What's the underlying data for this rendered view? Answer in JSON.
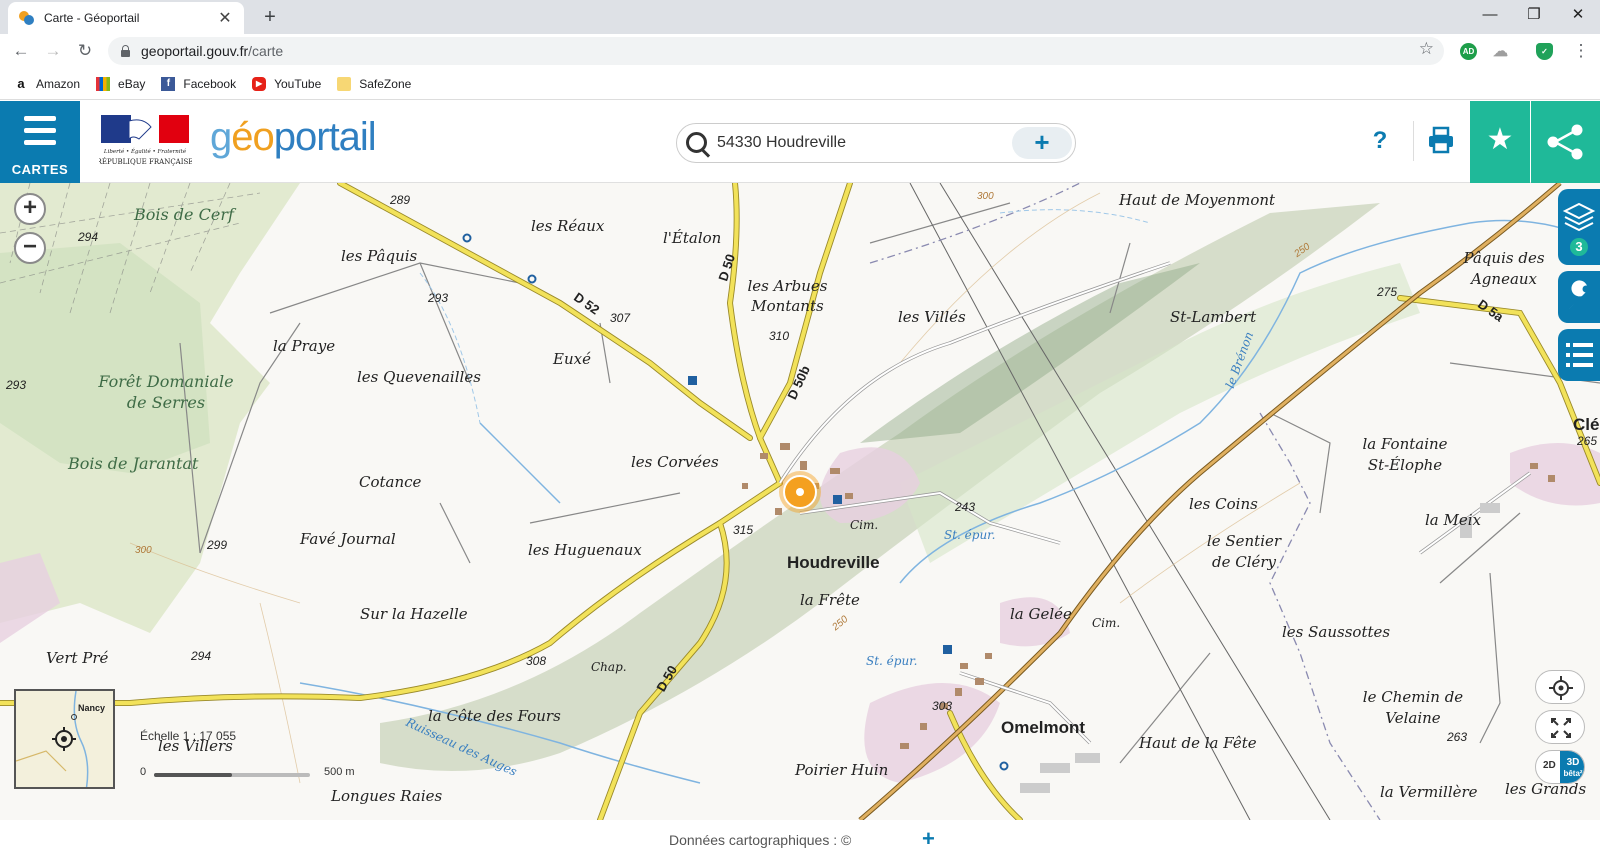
{
  "browser": {
    "tab_title": "Carte - Géoportail",
    "new_tab": "+",
    "url_host": "geoportail.gouv.fr",
    "url_path": "/carte",
    "bookmarks": [
      {
        "label": "Amazon",
        "icon": "amazon-icon"
      },
      {
        "label": "eBay",
        "icon": "ebay-icon"
      },
      {
        "label": "Facebook",
        "icon": "facebook-icon"
      },
      {
        "label": "YouTube",
        "icon": "youtube-icon"
      },
      {
        "label": "SafeZone",
        "icon": "folder-icon"
      }
    ],
    "extensions": [
      {
        "label": "AD",
        "color": "#1e9e4a"
      },
      {
        "label": "",
        "color": "#9e9e9e"
      },
      {
        "label": "✓",
        "color": "#20a25a"
      }
    ]
  },
  "header": {
    "menu_label": "CARTES",
    "logo_g": "g",
    "logo_e": "éo",
    "logo_rest": "portail",
    "marianne_line1": "Liberté • Égalité • Fraternité",
    "marianne_line2": "RÉPUBLIQUE FRANÇAISE",
    "search_value": "54330 Houdreville",
    "search_plus": "+",
    "help": "?",
    "colors": {
      "primary": "#0b7bb0",
      "accent": "#1fb999",
      "logo_orange": "#f0a020"
    }
  },
  "map": {
    "layers_count": "3",
    "place_labels": [
      "Bois de Cerf",
      "les Pâquis",
      "les Réaux",
      "l'Étalon",
      "Haut de Moyenmont",
      "les Arbues Montants",
      "les Villés",
      "St-Lambert",
      "Pâquis des Agneaux",
      "la Praye",
      "Forêt Domaniale de Serres",
      "les Quevenailles",
      "Euxé",
      "Bois de Jarantat",
      "les Corvées",
      "la Fontaine St-Élophe",
      "Cotance",
      "Favé Journal",
      "les Huguenaux",
      "les Coins",
      "la Meix",
      "le Sentier de Cléry",
      "Sur la Hazelle",
      "la Frête",
      "la Gelée",
      "les Saussottes",
      "Vert Pré",
      "le Chemin de Velaine",
      "la Côte des Fours",
      "les Villers",
      "Haut de la Fête",
      "Poirier Huin",
      "Longues Raies",
      "la Vermillère",
      "les Grands",
      "Chap.",
      "Cim.",
      "Clé"
    ],
    "towns": [
      "Houdreville",
      "Omelmont"
    ],
    "roads": [
      "D 52",
      "D 50",
      "D 50b",
      "D 5a"
    ],
    "altitudes": [
      "289",
      "294",
      "293",
      "307",
      "310",
      "315",
      "243",
      "299",
      "294",
      "308",
      "303",
      "275",
      "265",
      "263",
      "300",
      "250"
    ],
    "water_labels": [
      "St. épur.",
      "le Brénon",
      "Ruisseau des Auges"
    ],
    "overview_city": "Nancy",
    "scale_text": "Échelle 1 : 17 055",
    "scale_zero": "0",
    "scale_max": "500 m",
    "mode_2d": "2D",
    "mode_3d": "3D",
    "mode_beta": "bêta²"
  },
  "footer": {
    "text": "Données cartographiques : ©",
    "plus": "+"
  }
}
